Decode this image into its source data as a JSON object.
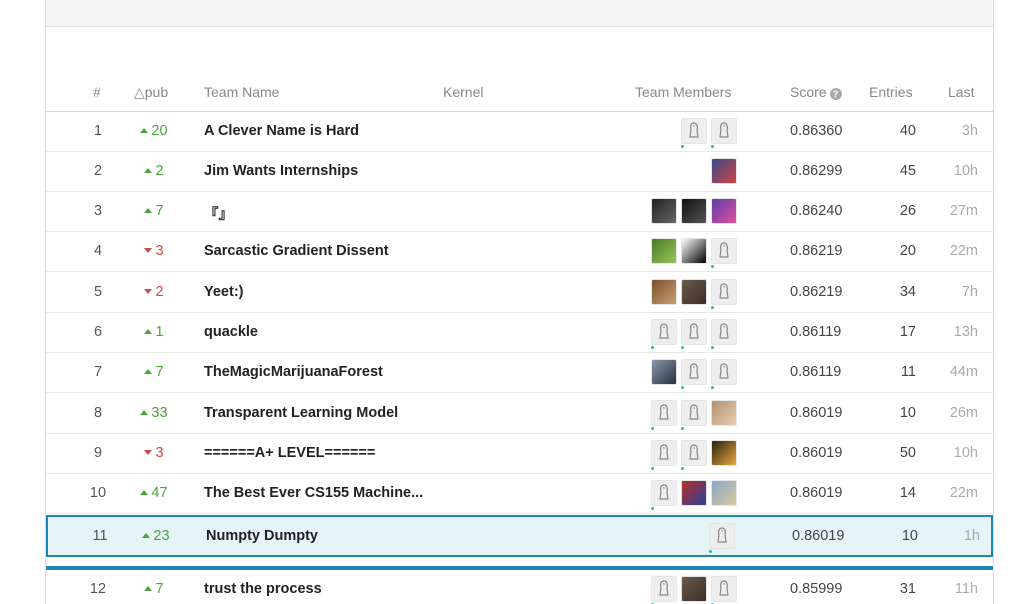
{
  "header": {
    "rank": "#",
    "delta": "△pub",
    "team_name": "Team Name",
    "kernel": "Kernel",
    "team_members": "Team Members",
    "score": "Score",
    "score_help": "?",
    "entries": "Entries",
    "last": "Last"
  },
  "rows": [
    {
      "rank": "1",
      "delta": "20",
      "dir": "up",
      "team": "A Clever Name is Hard",
      "score": "0.86360",
      "entries": "40",
      "last": "3h",
      "members": [
        "default",
        "default"
      ]
    },
    {
      "rank": "2",
      "delta": "2",
      "dir": "up",
      "team": "Jim Wants Internships",
      "score": "0.86299",
      "entries": "45",
      "last": "10h",
      "members": [
        "photo-blue"
      ]
    },
    {
      "rank": "3",
      "delta": "7",
      "dir": "up",
      "team": "『』",
      "score": "0.86240",
      "entries": "26",
      "last": "27m",
      "members": [
        "photo-purple",
        "photo-black-wolf",
        "photo-dark-figure"
      ]
    },
    {
      "rank": "4",
      "delta": "3",
      "dir": "down",
      "team": "Sarcastic Gradient Dissent",
      "score": "0.86219",
      "entries": "20",
      "last": "22m",
      "members": [
        "default",
        "sketch-face",
        "photo-green"
      ]
    },
    {
      "rank": "5",
      "delta": "2",
      "dir": "down",
      "team": "Yeet:)",
      "score": "0.86219",
      "entries": "34",
      "last": "7h",
      "members": [
        "default",
        "photo-person",
        "photo-brown"
      ]
    },
    {
      "rank": "6",
      "delta": "1",
      "dir": "up",
      "team": "quackle",
      "score": "0.86119",
      "entries": "17",
      "last": "13h",
      "members": [
        "default",
        "default",
        "default"
      ]
    },
    {
      "rank": "7",
      "delta": "7",
      "dir": "up",
      "team": "TheMagicMarijuanaForest",
      "score": "0.86119",
      "entries": "11",
      "last": "44m",
      "members": [
        "default",
        "default",
        "photo-landscape"
      ]
    },
    {
      "rank": "8",
      "delta": "33",
      "dir": "up",
      "team": "Transparent Learning Model",
      "score": "0.86019",
      "entries": "10",
      "last": "26m",
      "members": [
        "photo-person-light",
        "default",
        "default"
      ]
    },
    {
      "rank": "9",
      "delta": "3",
      "dir": "down",
      "team": "======A+ LEVEL======",
      "score": "0.86019",
      "entries": "50",
      "last": "10h",
      "members": [
        "photo-sunset",
        "default",
        "default"
      ]
    },
    {
      "rank": "10",
      "delta": "47",
      "dir": "up",
      "team": "The Best Ever CS155 Machine...",
      "score": "0.86019",
      "entries": "14",
      "last": "22m",
      "members": [
        "photo-beach",
        "photo-group",
        "default"
      ]
    },
    {
      "rank": "11",
      "delta": "23",
      "dir": "up",
      "team": "Numpty Dumpty",
      "score": "0.86019",
      "entries": "10",
      "last": "1h",
      "members": [
        "default"
      ]
    },
    {
      "rank": "12",
      "delta": "7",
      "dir": "up",
      "team": "trust the process",
      "score": "0.85999",
      "entries": "31",
      "last": "11h",
      "members": [
        "default",
        "photo-person",
        "default"
      ]
    }
  ],
  "colors": {
    "up": "#4fa33d",
    "down": "#cc4b4b",
    "highlight_border": "#1e86b8",
    "highlight_bg": "#e6f3f7"
  }
}
